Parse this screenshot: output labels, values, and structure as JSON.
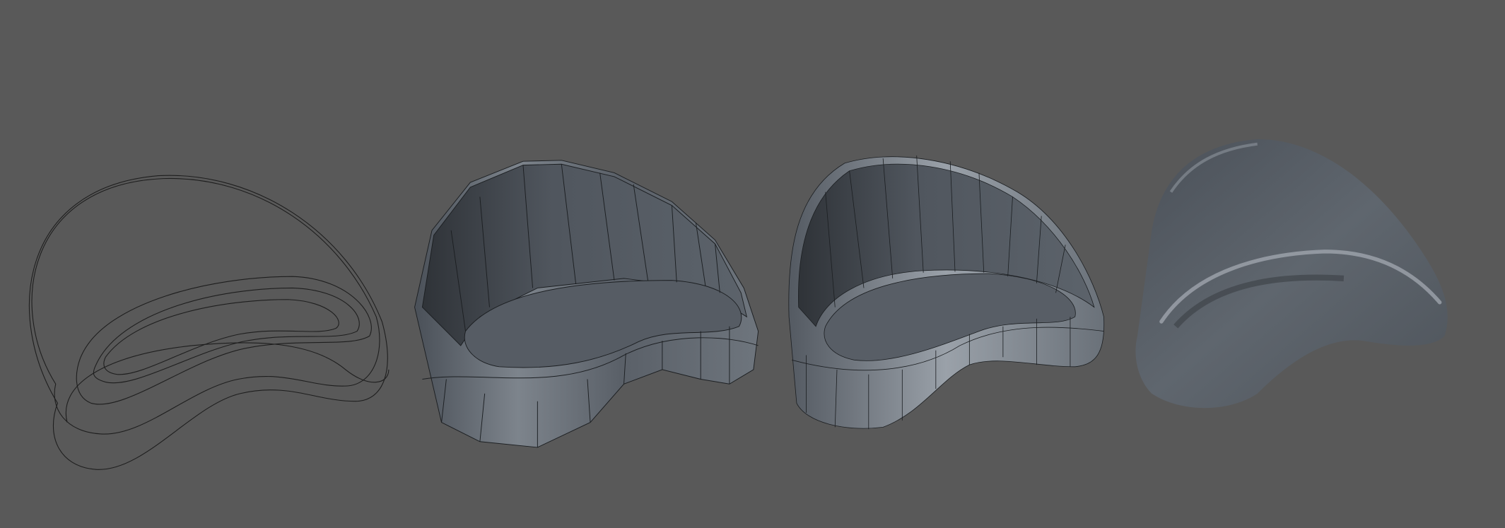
{
  "viewport": {
    "background_color": "#595959",
    "models": [
      {
        "name": "curve-wireframe",
        "stroke_color": "#1e1e1e"
      },
      {
        "name": "low-poly-mesh",
        "fill_color": "#5a6068",
        "edge_color": "#1c1f22"
      },
      {
        "name": "subdivided-mesh",
        "fill_color": "#5b616a",
        "edge_color": "#1c1f22"
      },
      {
        "name": "smooth-shaded",
        "fill_color": "#5c636c",
        "highlight_color": "#aab0b8"
      }
    ]
  }
}
